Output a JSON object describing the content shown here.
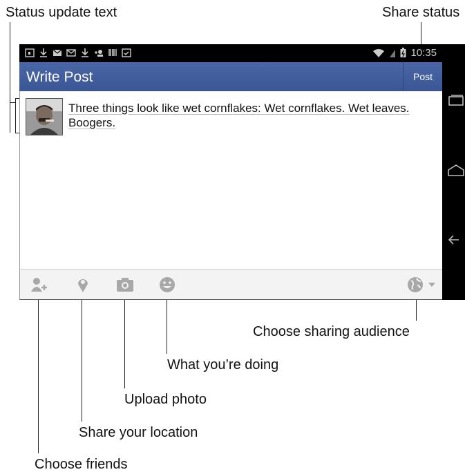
{
  "callouts": {
    "status_update_text": "Status update text",
    "share_status": "Share status",
    "choose_sharing_audience": "Choose sharing audience",
    "what_youre_doing": "What you’re doing",
    "upload_photo": "Upload photo",
    "share_your_location": "Share your location",
    "choose_friends": "Choose friends"
  },
  "status_bar": {
    "time": "10:35",
    "icons": [
      "calendar-icon",
      "download-icon",
      "mail-icon",
      "gmail-icon",
      "download-icon",
      "add-contact-icon",
      "barcode-icon",
      "checklist-icon"
    ],
    "right_icons": [
      "wifi-icon",
      "signal-icon",
      "battery-icon"
    ]
  },
  "header": {
    "title": "Write Post",
    "post_label": "Post"
  },
  "post": {
    "text": "Three things look like wet cornflakes: Wet cornflakes. Wet leaves. Boogers."
  },
  "toolbar": {
    "icons": [
      "tag-friends-icon",
      "location-pin-icon",
      "camera-icon",
      "smiley-icon",
      "globe-icon",
      "chevron-down-icon"
    ]
  },
  "nav_bar": {
    "icons": [
      "recent-apps-icon",
      "home-icon",
      "back-icon"
    ]
  },
  "colors": {
    "header": "#3b5998",
    "toolbar_icons": "#a8a8a8"
  }
}
